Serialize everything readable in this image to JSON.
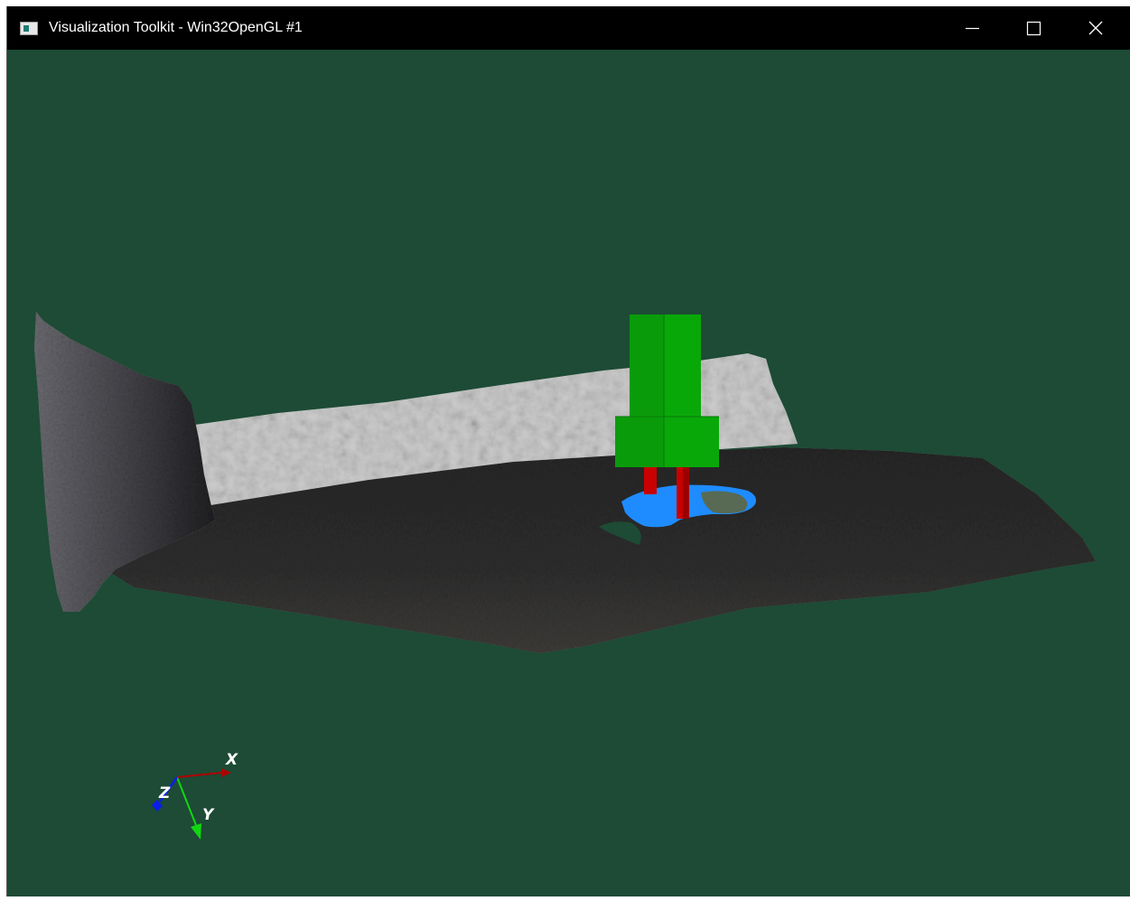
{
  "window": {
    "title": "Visualization Toolkit - Win32OpenGL #1",
    "icon": "vtk-window-icon",
    "controls": {
      "minimize_icon": "minimize-icon",
      "maximize_icon": "maximize-icon",
      "close_icon": "close-icon"
    }
  },
  "viewport": {
    "background_color": "#1d4b35",
    "scene_objects": [
      "scanned-wall-left",
      "scanned-wall-back",
      "scanned-floor",
      "blue-disc-patch",
      "red-legs",
      "green-block-model"
    ],
    "colors": {
      "block": "#0aa00a",
      "legs": "#c80000",
      "patch": "#1e8cff",
      "floor": "#2a2a2a",
      "wall": "#cfcfcf"
    }
  },
  "axes_widget": {
    "x_label": "X",
    "y_label": "Y",
    "z_label": "Z",
    "x_color": "#b00000",
    "y_color": "#12d612",
    "z_color": "#0a1ee6"
  }
}
